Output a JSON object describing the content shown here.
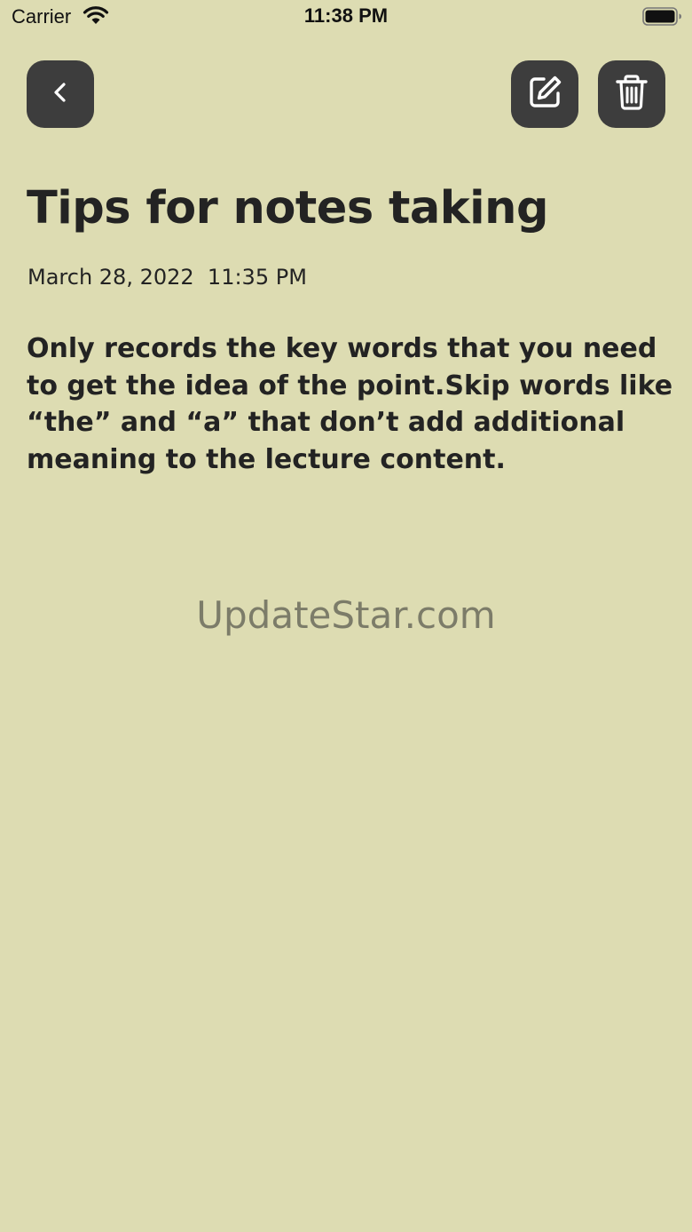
{
  "status_bar": {
    "carrier": "Carrier",
    "time": "11:38 PM",
    "wifi_icon": "wifi-icon",
    "battery_icon": "battery-icon",
    "battery_level": 0.95
  },
  "toolbar": {
    "back_icon": "chevron-left-icon",
    "edit_icon": "edit-icon",
    "delete_icon": "trash-icon"
  },
  "note": {
    "title": "Tips for notes taking",
    "date": "March 28, 2022  11:35 PM",
    "body": "Only records the key words that you need to get the idea of the point.Skip words like “the” and “a” that don’t add additional meaning to the lecture content."
  },
  "watermark": "UpdateStar.com",
  "colors": {
    "background": "#dddcb2",
    "button": "#3d3d3d",
    "text": "#232323",
    "watermark": "#7c7c69"
  }
}
